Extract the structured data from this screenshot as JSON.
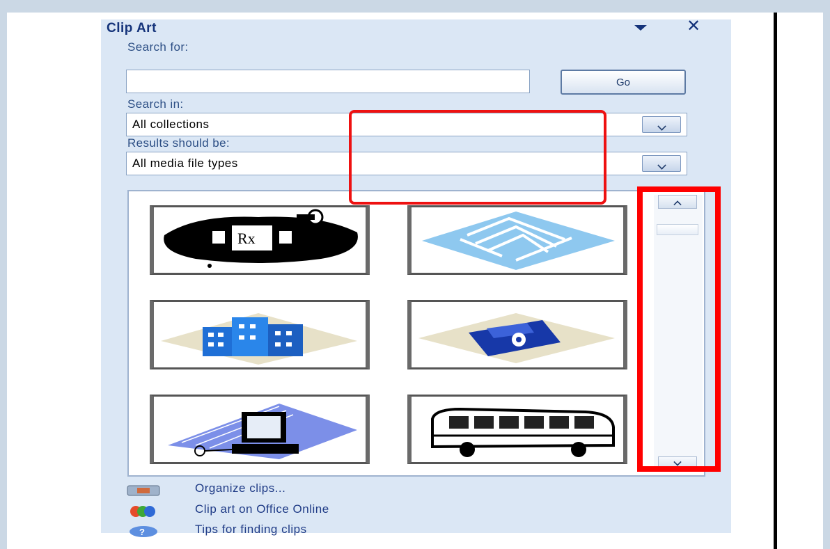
{
  "pane": {
    "title": "Clip Art",
    "menu_icon": "chevron-down-icon",
    "close_icon": "✕"
  },
  "search": {
    "label": "Search for:",
    "value": "",
    "go_label": "Go"
  },
  "search_in": {
    "label": "Search in:",
    "selected": "All collections"
  },
  "results_type": {
    "label": "Results should be:",
    "selected": "All media file types"
  },
  "results": {
    "thumbnails": [
      {
        "name": "prescription-mortar-clip"
      },
      {
        "name": "circuit-board-clip"
      },
      {
        "name": "office-building-clip"
      },
      {
        "name": "floppy-disk-clip"
      },
      {
        "name": "computer-network-clip"
      },
      {
        "name": "bus-clip"
      }
    ],
    "rx_text": "Rx"
  },
  "colors": {
    "highlight": "#ff0000",
    "link": "#1f3b86",
    "pane_bg": "#dbe7f5"
  },
  "links": [
    {
      "label": "Organize clips...",
      "icon": "organize-icon"
    },
    {
      "label": "Clip art on Office Online",
      "icon": "office-online-icon"
    },
    {
      "label": "Tips for finding clips",
      "icon": "help-icon"
    }
  ]
}
